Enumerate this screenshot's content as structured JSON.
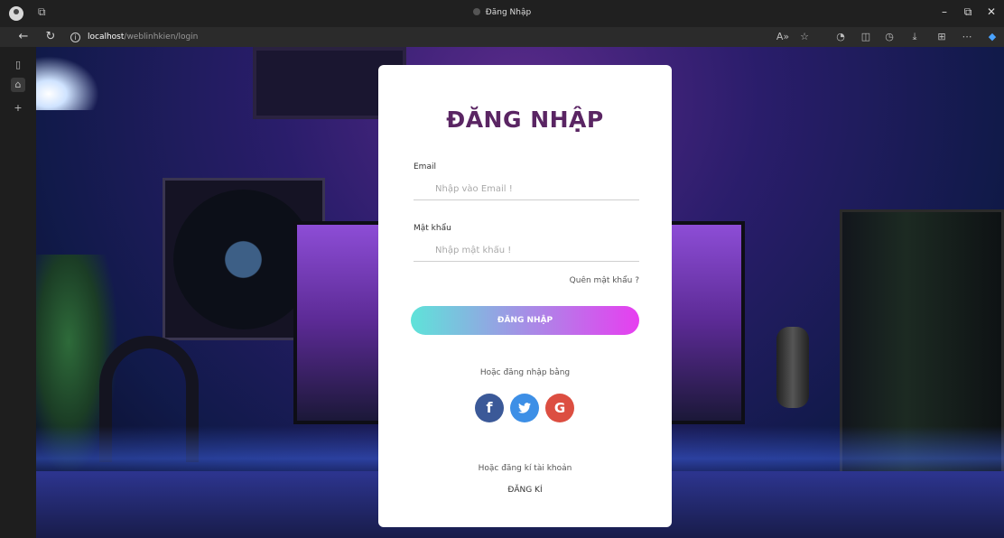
{
  "browser": {
    "tab_title": "Đăng Nhập",
    "url_host": "localhost",
    "url_path": "/weblinhkien/login",
    "icons": {
      "profile": "profile-icon",
      "tabs": "tab-actions-icon",
      "back": "back-arrow-icon",
      "refresh": "refresh-icon",
      "info": "site-info-icon",
      "read_aloud": "read-aloud-icon",
      "favorite": "favorite-star-icon",
      "extensions": "extensions-icon",
      "split": "split-screen-icon",
      "history": "history-icon",
      "downloads": "download-icon",
      "collections": "collections-icon",
      "more": "more-icon",
      "copilot": "copilot-icon"
    },
    "window_controls": {
      "minimize": "–",
      "restore": "⧉",
      "close": "✕"
    }
  },
  "sidebar": {
    "icons": [
      "vertical-tabs-icon",
      "home-icon",
      "add-tab-icon"
    ]
  },
  "login": {
    "title": "ĐĂNG NHẬP",
    "email_label": "Email",
    "email_placeholder": "Nhập vào Email !",
    "password_label": "Mật khẩu",
    "password_placeholder": "Nhập mật khẩu !",
    "forgot_password": "Quên mật khẩu ?",
    "submit_label": "ĐĂNG NHẬP",
    "social_prompt": "Hoặc đăng nhập bằng",
    "social": {
      "facebook": "f",
      "twitter": "t",
      "google": "G"
    },
    "register_prompt": "Hoặc đăng kí tài khoản",
    "register_link": "ĐĂNG KÍ"
  },
  "colors": {
    "title": "#5a2563",
    "button_gradient_start": "#5ee3d9",
    "button_gradient_end": "#e73ef0",
    "facebook": "#3b5998",
    "twitter": "#3d8fe6",
    "google": "#dc4e41"
  }
}
